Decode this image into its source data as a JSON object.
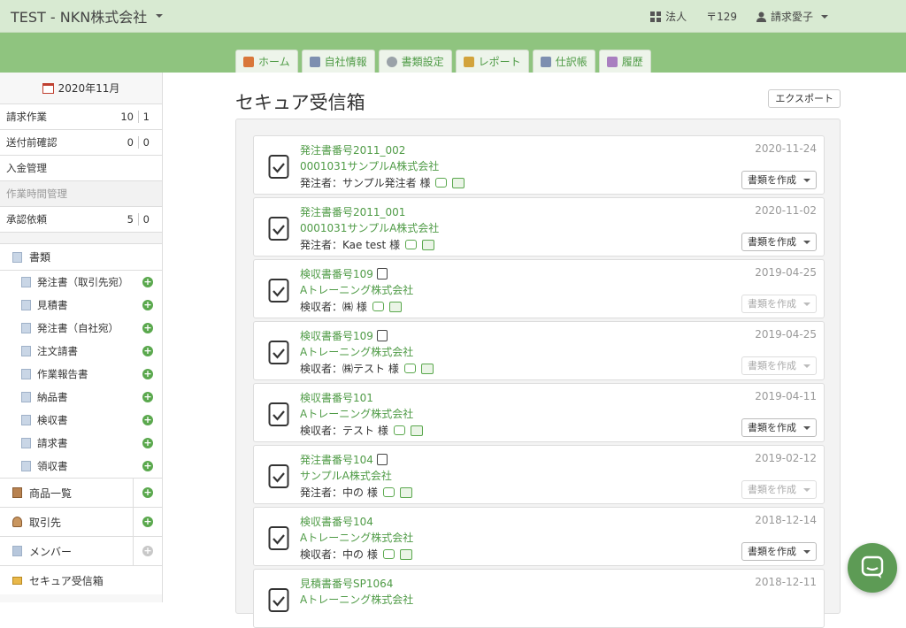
{
  "topbar": {
    "brand": "TEST - NKN株式会社",
    "corp_label": "法人",
    "postal_label": "〒129",
    "user_label": "請求愛子"
  },
  "tabs": [
    {
      "label": "ホーム",
      "icon": "home-icon",
      "color": "#d9773a"
    },
    {
      "label": "自社情報",
      "icon": "building-icon",
      "color": "#7d8fb0"
    },
    {
      "label": "書類設定",
      "icon": "gear-icon",
      "color": "#9aa2a8"
    },
    {
      "label": "レポート",
      "icon": "chart-icon",
      "color": "#d2a33c"
    },
    {
      "label": "仕訳帳",
      "icon": "ledger-icon",
      "color": "#7d8fb0"
    },
    {
      "label": "履歴",
      "icon": "history-icon",
      "color": "#a97fc0"
    }
  ],
  "sidebar": {
    "month": "2020年11月",
    "status_rows": [
      {
        "label": "請求作業",
        "n1": "10",
        "n2": "1",
        "dim": false
      },
      {
        "label": "送付前確認",
        "n1": "0",
        "n2": "0",
        "dim": false
      },
      {
        "label": "入金管理",
        "n1": "",
        "n2": "",
        "dim": false
      },
      {
        "label": "作業時間管理",
        "n1": "",
        "n2": "",
        "dim": true
      },
      {
        "label": "承認依頼",
        "n1": "5",
        "n2": "0",
        "dim": false
      }
    ],
    "docs_header": "書類",
    "doc_items": [
      "発注書（取引先宛）",
      "見積書",
      "発注書（自社宛）",
      "注文請書",
      "作業報告書",
      "納品書",
      "検収書",
      "請求書",
      "領収書"
    ],
    "products": "商品一覧",
    "clients": "取引先",
    "members": "メンバー",
    "inbox": "セキュア受信箱"
  },
  "main": {
    "title": "セキュア受信箱",
    "export_label": "エクスポート",
    "create_label": "書類を作成"
  },
  "cards": [
    {
      "title": "発注書番号2011_002",
      "company": "0001031サンプルA株式会社",
      "person": "発注者：サンプル発注者 様",
      "date": "2020-11-24",
      "tag": false,
      "enabled": true
    },
    {
      "title": "発注書番号2011_001",
      "company": "0001031サンプルA株式会社",
      "person": "発注者：Kae test 様",
      "date": "2020-11-02",
      "tag": false,
      "enabled": true
    },
    {
      "title": "検収書番号109",
      "company": "Aトレーニング株式会社",
      "person": "検収者：㈱ 様",
      "date": "2019-04-25",
      "tag": true,
      "enabled": false
    },
    {
      "title": "検収書番号109",
      "company": "Aトレーニング株式会社",
      "person": "検収者：㈱テスト 様",
      "date": "2019-04-25",
      "tag": true,
      "enabled": false
    },
    {
      "title": "検収書番号101",
      "company": "Aトレーニング株式会社",
      "person": "検収者：テスト 様",
      "date": "2019-04-11",
      "tag": false,
      "enabled": true
    },
    {
      "title": "発注書番号104",
      "company": "サンプルA株式会社",
      "person": "発注者：中の 様",
      "date": "2019-02-12",
      "tag": true,
      "enabled": false
    },
    {
      "title": "検収書番号104",
      "company": "Aトレーニング株式会社",
      "person": "検収者：中の 様",
      "date": "2018-12-14",
      "tag": false,
      "enabled": true
    },
    {
      "title": "見積書番号SP1064",
      "company": "Aトレーニング株式会社",
      "person": "",
      "date": "2018-12-11",
      "tag": false,
      "enabled": true
    }
  ]
}
